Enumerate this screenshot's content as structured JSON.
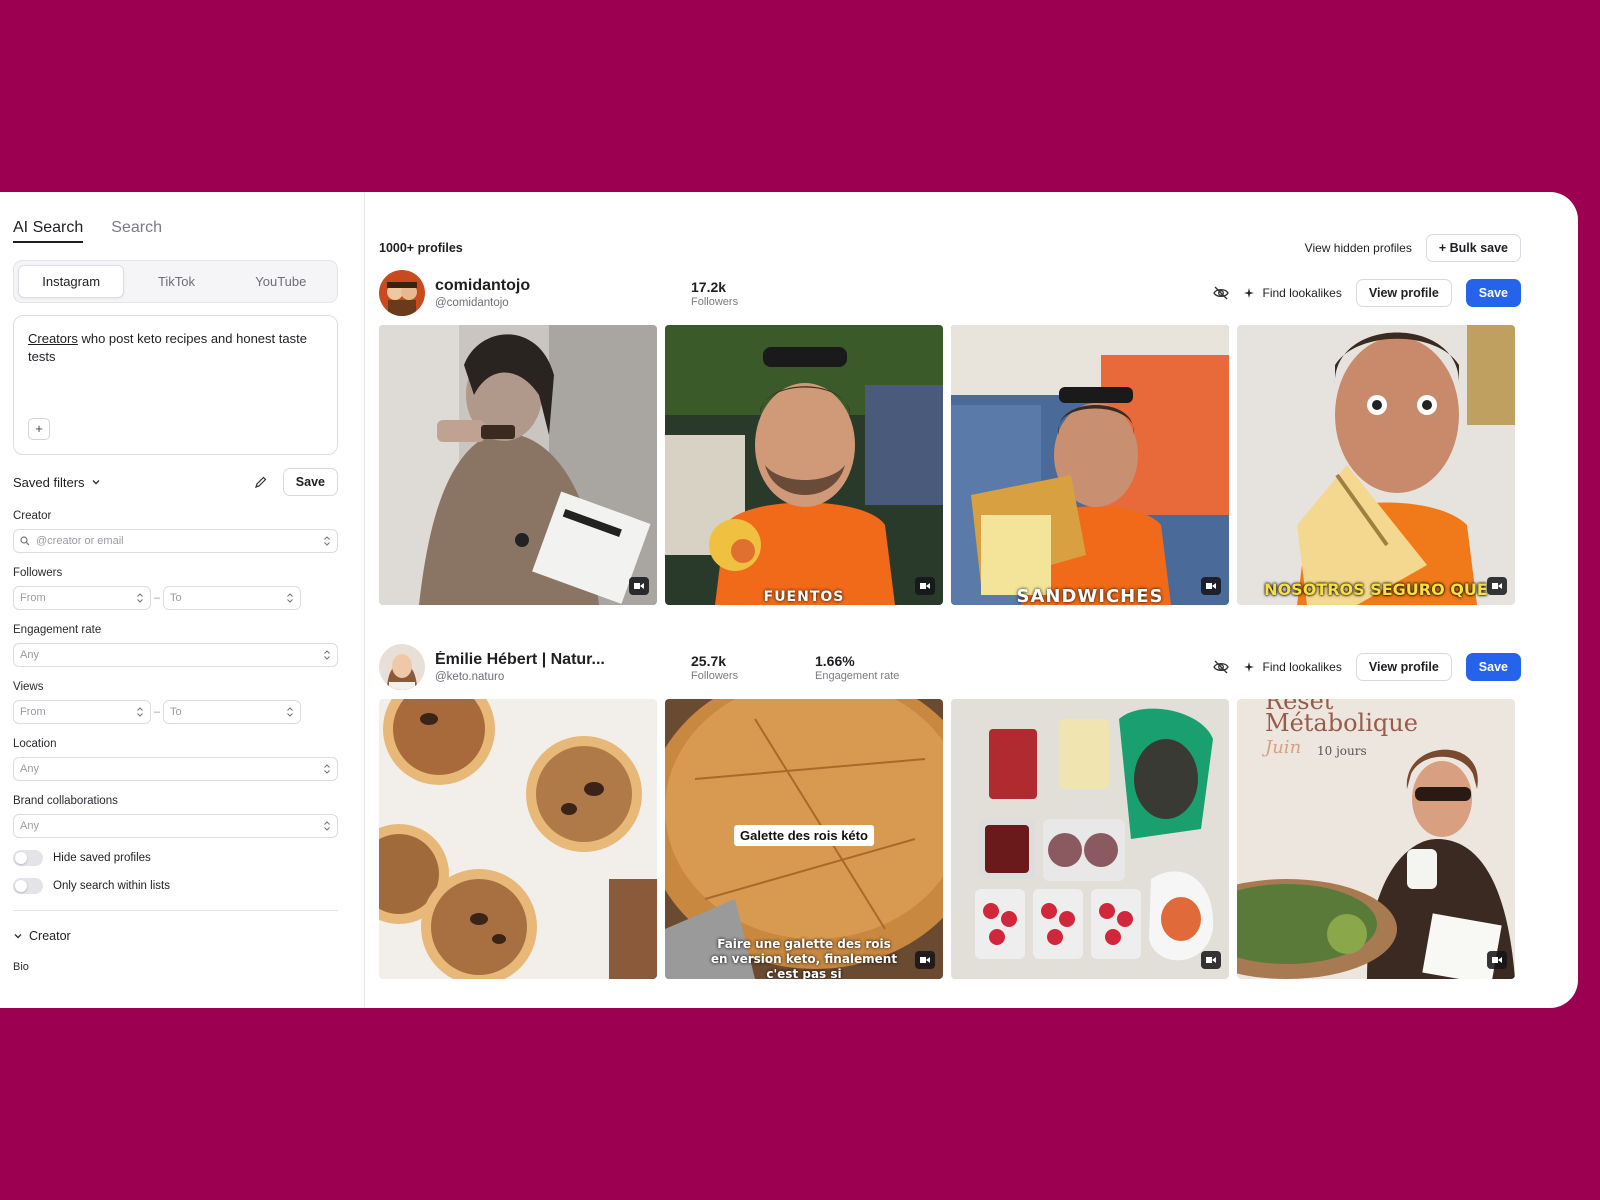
{
  "sidebar": {
    "mode_tabs": [
      "AI Search",
      "Search"
    ],
    "platforms": [
      "Instagram",
      "TikTok",
      "YouTube"
    ],
    "prompt": {
      "underlined": "Creators",
      "rest": " who post keto recipes and honest taste tests"
    },
    "saved_filters_label": "Saved filters",
    "save_label": "Save",
    "creator": {
      "label": "Creator",
      "placeholder": "@creator or email"
    },
    "followers": {
      "label": "Followers",
      "from": "From",
      "to": "To"
    },
    "engagement": {
      "label": "Engagement rate",
      "value": "Any"
    },
    "views": {
      "label": "Views",
      "from": "From",
      "to": "To"
    },
    "location": {
      "label": "Location",
      "value": "Any"
    },
    "brand": {
      "label": "Brand collaborations",
      "value": "Any"
    },
    "toggles": [
      "Hide saved profiles",
      "Only search within lists"
    ],
    "section": "Creator",
    "bio_label": "Bio",
    "range_dash": "–"
  },
  "main": {
    "count": "1000+ profiles",
    "view_hidden": "View hidden profiles",
    "bulk_save": "+ Bulk save",
    "find_lookalikes": "Find lookalikes",
    "view_profile": "View profile",
    "save": "Save",
    "profiles": [
      {
        "name": "comidantojo",
        "handle": "@comidantojo",
        "followers_value": "17.2k",
        "followers_label": "Followers",
        "captions": [
          "FUENTOS",
          "SANDWICHES",
          "NOSOTROS SEGURO QUE"
        ]
      },
      {
        "name": "Émilie Hébert | Natur...",
        "handle": "@keto.naturo",
        "followers_value": "25.7k",
        "followers_label": "Followers",
        "engagement_value": "1.66%",
        "engagement_label": "Engagement rate",
        "pill": "Galette des rois kéto",
        "sub1": "Faire une galette des rois",
        "sub2": "en version keto, finalement",
        "sub3": "c'est pas si",
        "reset1": "Reset",
        "reset2": "Métabolique",
        "reset3": "Juin",
        "reset4": "10 jours"
      }
    ]
  },
  "colors": {
    "background": "#9c0050",
    "primary": "#2563eb"
  }
}
